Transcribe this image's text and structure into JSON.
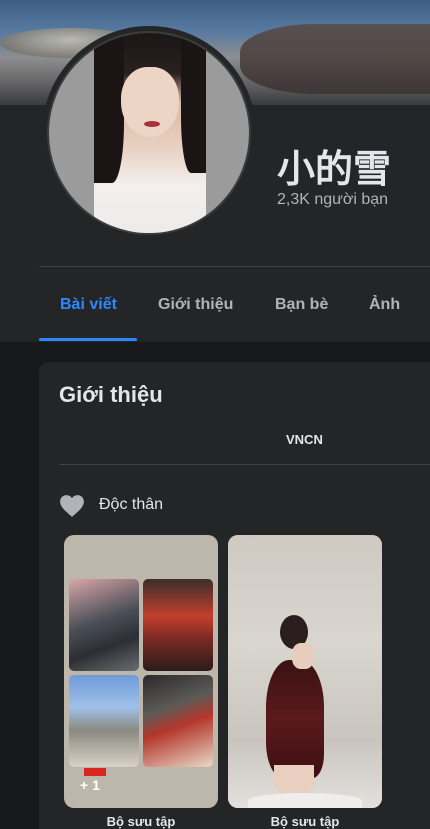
{
  "profile": {
    "name": "小的雪",
    "friends_count": "2,3K người bạn"
  },
  "tabs": [
    {
      "label": "Bài viết",
      "active": true
    },
    {
      "label": "Giới thiệu",
      "active": false
    },
    {
      "label": "Bạn bè",
      "active": false
    },
    {
      "label": "Ảnh",
      "active": false
    }
  ],
  "intro": {
    "title": "Giới thiệu",
    "bio": "VNCN",
    "relationship": "Độc thân",
    "relationship_icon": "heart-icon"
  },
  "collections": [
    {
      "label": "Bộ sưu tập",
      "extra_count": "+ 1"
    },
    {
      "label": "Bộ sưu tập"
    }
  ],
  "colors": {
    "accent": "#2d88ff",
    "background": "#18191a",
    "card": "#242526"
  }
}
